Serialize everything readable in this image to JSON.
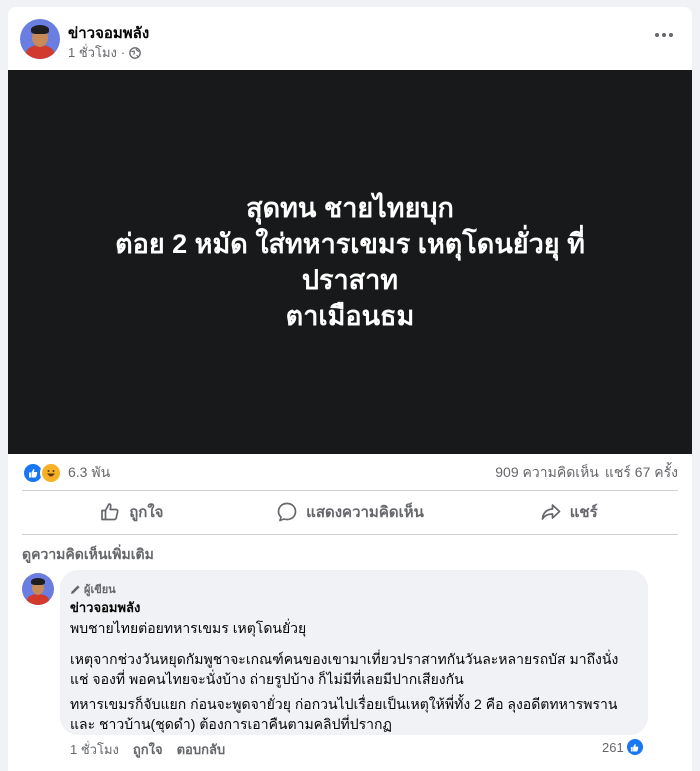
{
  "post": {
    "page_name": "ข่าวจอมพลัง",
    "time": "1 ชั่วโมง",
    "separator": "·",
    "privacy_icon": "globe-icon"
  },
  "media": {
    "lines": [
      "สุดทน ชายไทยบุก",
      "ต่อย 2 หมัด ใส่ทหารเขมร เหตุโดนยั่วยุ ที่",
      "ปราสาท",
      "ตาเมือนธม"
    ],
    "background": "#18191a"
  },
  "stats": {
    "reactions": "6.3 พัน",
    "comments": "909 ความคิดเห็น",
    "shares": "แชร์ 67 ครั้ง"
  },
  "actions": {
    "like": "ถูกใจ",
    "comment": "แสดงความคิดเห็น",
    "share": "แชร์"
  },
  "comments_section": {
    "more_comments": "ดูความคิดเห็นเพิ่มเติม"
  },
  "comment": {
    "badge": "ผู้เขียน",
    "author": "ข่าวจอมพลัง",
    "para1": [
      "พบชายไทยต่อยทหารเขมร เหตุโดนยั่วยุ"
    ],
    "para2": [
      "เหตุจากช่วงวันหยุดกัมพูชาจะเกณฑ์คนของเขามาเที่ยวปราสาทกันวันละหลายรถบัส มาถึงนั่ง",
      "แช่ จองที่ พอคนไทยจะนั่งบ้าง ถ่ายรูปบ้าง ก็ไม่มีที่เลยมีปากเสียงกัน"
    ],
    "para3": [
      "ทหารเขมรก็จับแยก ก่อนจะพูดจายั่วยุ ก่อกวนไปเรื่อยเป็นเหตุให้พี่ทั้ง 2 คือ ลุงอดีตทหารพราน",
      "และ ชาวบ้าน(ชุดดำ) ต้องการเอาคืนตามคลิปที่ปรากฏ"
    ],
    "time": "1 ชั่วโมง",
    "like": "ถูกใจ",
    "reply": "ตอบกลับ",
    "likes": "261"
  },
  "colors": {
    "accent": "#1877f2",
    "secondary_text": "#65676b",
    "bubble": "#f0f2f5"
  }
}
